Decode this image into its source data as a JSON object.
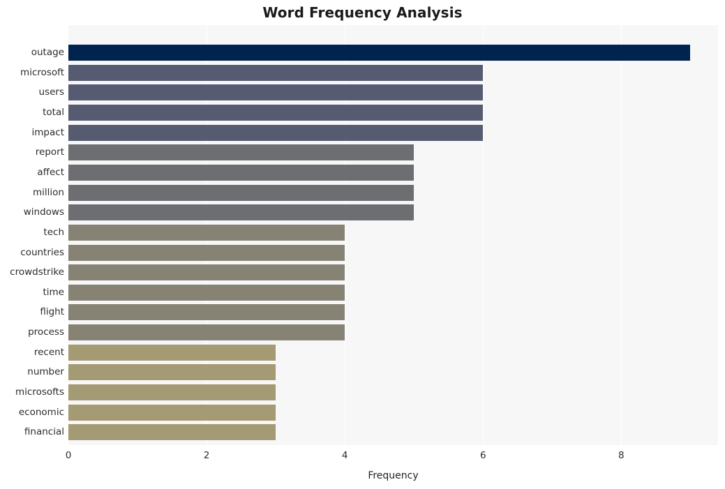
{
  "chart_data": {
    "type": "bar",
    "orientation": "horizontal",
    "title": "Word Frequency Analysis",
    "xlabel": "Frequency",
    "ylabel": "",
    "categories": [
      "outage",
      "microsoft",
      "users",
      "total",
      "impact",
      "report",
      "affect",
      "million",
      "windows",
      "tech",
      "countries",
      "crowdstrike",
      "time",
      "flight",
      "process",
      "recent",
      "number",
      "microsofts",
      "economic",
      "financial"
    ],
    "values": [
      9,
      6,
      6,
      6,
      6,
      5,
      5,
      5,
      5,
      4,
      4,
      4,
      4,
      4,
      4,
      3,
      3,
      3,
      3,
      3
    ],
    "bar_colors": [
      "#00244f",
      "#565b72",
      "#565b72",
      "#565b72",
      "#565b72",
      "#6d6e71",
      "#6d6e71",
      "#6d6e71",
      "#6d6e71",
      "#868375",
      "#868375",
      "#868375",
      "#868375",
      "#868375",
      "#868375",
      "#a49a73",
      "#a49a73",
      "#a49a73",
      "#a49a73",
      "#a49a73"
    ],
    "xlim": [
      0,
      9.4
    ],
    "xticks": [
      0,
      2,
      4,
      6,
      8
    ],
    "xtick_labels": [
      "0",
      "2",
      "4",
      "6",
      "8"
    ],
    "grid": true,
    "grid_axis": "x",
    "grid_color": "#ffffff",
    "plot_background": "#f7f7f7",
    "figure_background": "#ffffff",
    "legend": null
  }
}
